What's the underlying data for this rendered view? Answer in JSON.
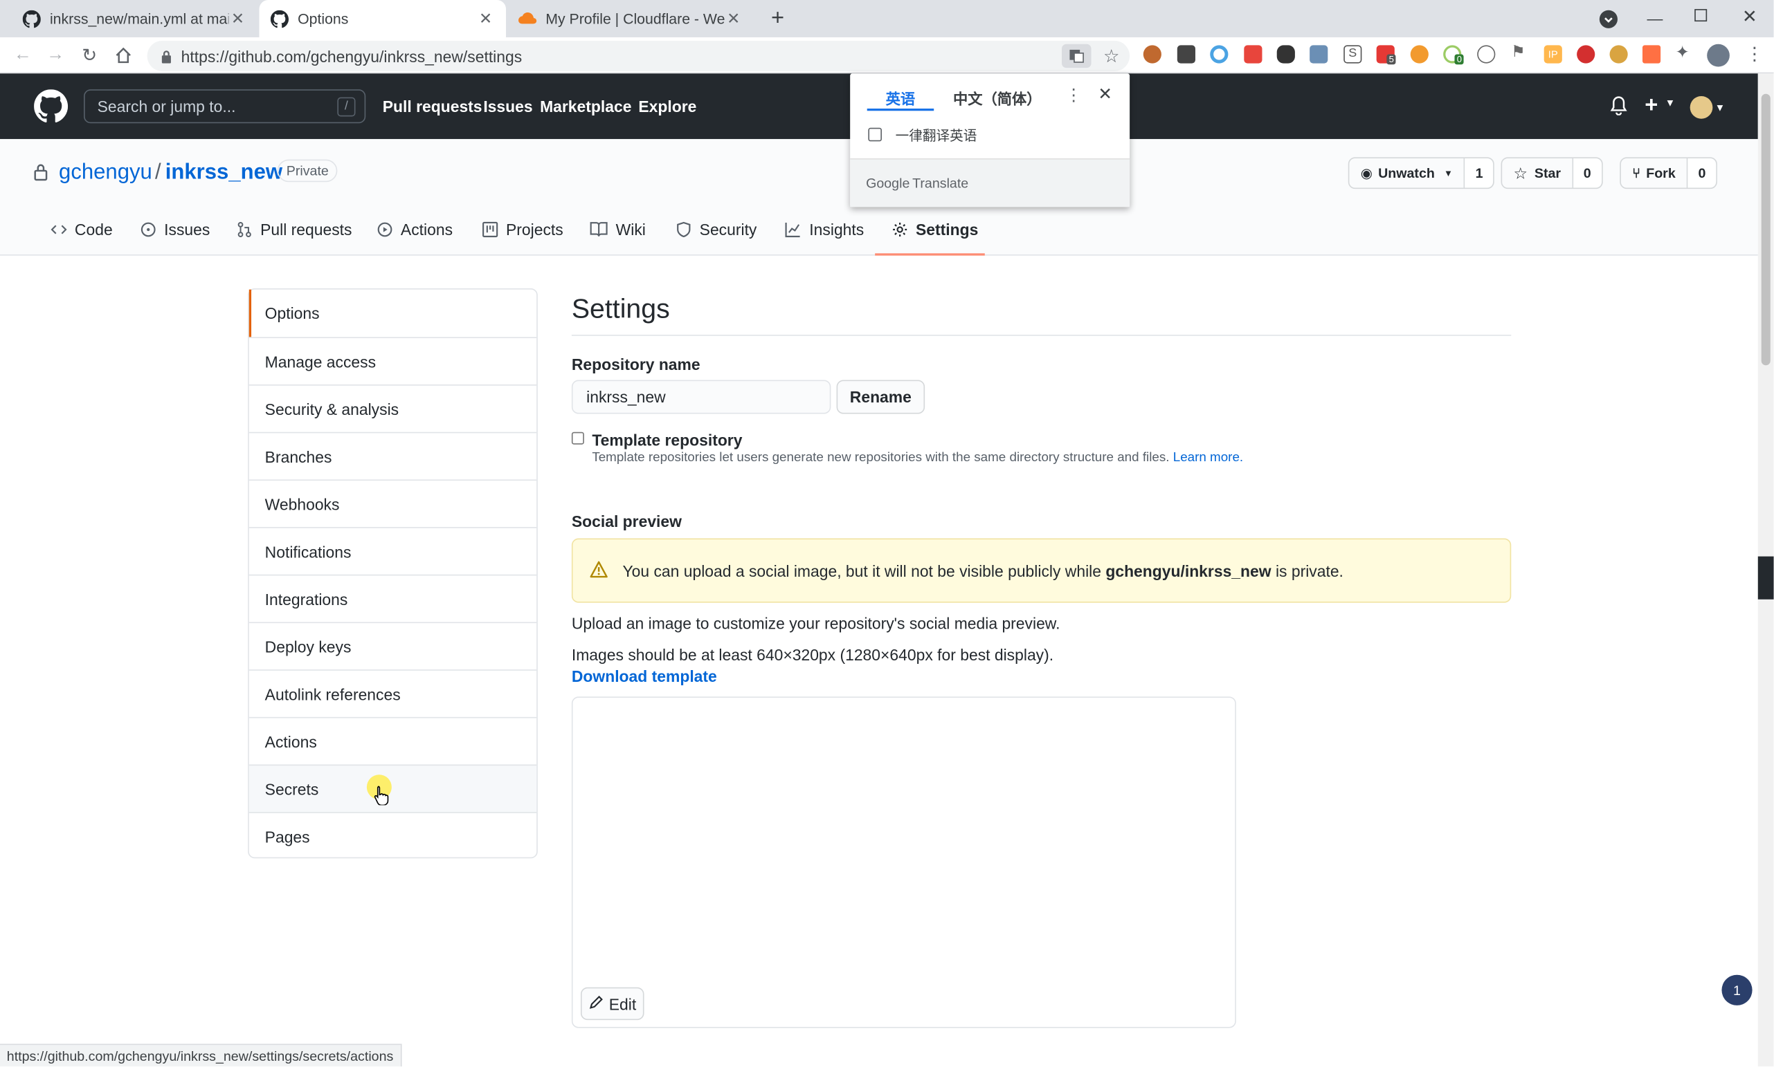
{
  "browser": {
    "tabs": [
      {
        "title": "inkrss_new/main.yml at main · "
      },
      {
        "title": "Options"
      },
      {
        "title": "My Profile | Cloudflare - Web P"
      }
    ],
    "new_tab": "+",
    "url": "https://github.com/gchengyu/inkrss_new/settings",
    "ext_badges": {
      "b1": "5",
      "b2": "0"
    }
  },
  "github": {
    "search_placeholder": "Search or jump to...",
    "search_key": "/",
    "nav": [
      "Pull requests",
      "Issues",
      "Marketplace",
      "Explore"
    ],
    "plus": "+"
  },
  "repo": {
    "owner": "gchengyu",
    "sep": "/",
    "name": "inkrss_new",
    "visibility": "Private",
    "watch_label": "Unwatch",
    "watch_count": "1",
    "star_label": "Star",
    "star_count": "0",
    "fork_label": "Fork",
    "fork_count": "0",
    "tabs": [
      "Code",
      "Issues",
      "Pull requests",
      "Actions",
      "Projects",
      "Wiki",
      "Security",
      "Insights",
      "Settings"
    ]
  },
  "sidebar": {
    "items": [
      "Options",
      "Manage access",
      "Security & analysis",
      "Branches",
      "Webhooks",
      "Notifications",
      "Integrations",
      "Deploy keys",
      "Autolink references",
      "Actions",
      "Secrets",
      "Pages"
    ]
  },
  "settings": {
    "heading": "Settings",
    "repo_name_label": "Repository name",
    "repo_name_value": "inkrss_new",
    "rename_button": "Rename",
    "template_label": "Template repository",
    "template_note": "Template repositories let users generate new repositories with the same directory structure and files.",
    "learn_more": "Learn more.",
    "social_heading": "Social preview",
    "flash_pre": "You can upload a social image, but it will not be visible publicly while ",
    "flash_repo": "gchengyu/inkrss_new",
    "flash_post": " is private.",
    "upload_text": "Upload an image to customize your repository's social media preview.",
    "size_text": "Images should be at least 640×320px (1280×640px for best display).",
    "download_template": "Download template",
    "edit_button": "Edit"
  },
  "translate_popup": {
    "tab_source": "英语",
    "tab_target": "中文（简体）",
    "always_translate": "一律翻译英语",
    "brand_google": "Google",
    "brand_translate": "Translate"
  },
  "status_url": "https://github.com/gchengyu/inkrss_new/settings/secrets/actions",
  "notification_count": "1",
  "colors": {
    "accent_tab": "#fd8c73",
    "link": "#0366d6",
    "flash_bg": "#fffbdd",
    "header_bg": "#24292e"
  }
}
